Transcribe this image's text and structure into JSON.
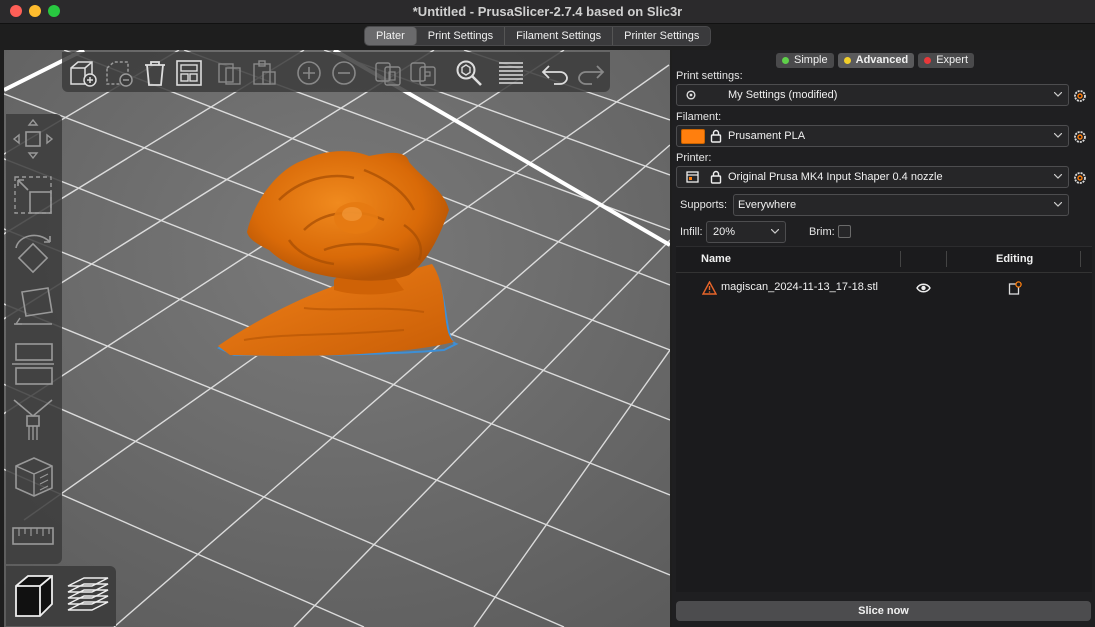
{
  "window": {
    "title": "*Untitled - PrusaSlicer-2.7.4 based on Slic3r"
  },
  "tabs": [
    {
      "label": "Plater",
      "active": true
    },
    {
      "label": "Print Settings",
      "active": false
    },
    {
      "label": "Filament Settings",
      "active": false
    },
    {
      "label": "Printer Settings",
      "active": false
    }
  ],
  "modes": [
    {
      "label": "Simple",
      "color": "#5fd04a",
      "active": false
    },
    {
      "label": "Advanced",
      "color": "#f2cf2a",
      "active": true
    },
    {
      "label": "Expert",
      "color": "#e8383a",
      "active": false
    }
  ],
  "print_settings": {
    "label": "Print settings:",
    "value": "My Settings (modified)"
  },
  "filament": {
    "label": "Filament:",
    "value": "Prusament PLA",
    "color": "#ff7f0e"
  },
  "printer": {
    "label": "Printer:",
    "value": "Original Prusa MK4 Input Shaper 0.4 nozzle"
  },
  "supports": {
    "label": "Supports:",
    "value": "Everywhere"
  },
  "infill": {
    "label": "Infill:",
    "value": "20%"
  },
  "brim": {
    "label": "Brim:",
    "checked": false
  },
  "object_list": {
    "columns": {
      "name": "Name",
      "editing": "Editing"
    },
    "rows": [
      {
        "name": "magiscan_2024-11-13_17-18.stl",
        "warning": true,
        "visible": true
      }
    ]
  },
  "actions": {
    "slice": "Slice now"
  },
  "icons": {
    "toolbar_top": [
      "add-icon",
      "delete-icon",
      "delete-all-icon",
      "arrange-icon",
      "copy-icon",
      "paste-icon",
      "add-instance-icon",
      "remove-instance-icon",
      "split-objects-icon",
      "split-parts-icon",
      "search-icon",
      "layers-editing-icon",
      "undo-icon",
      "redo-icon"
    ],
    "toolbar_left": [
      "move-icon",
      "scale-icon",
      "rotate-icon",
      "place-on-face-icon",
      "cut-icon",
      "paint-supports-icon",
      "measure-icon"
    ],
    "view": [
      "3d-view-icon",
      "preview-icon"
    ]
  },
  "colors": {
    "model": "#e8740f",
    "accent": "#ff7f0e",
    "bed": "#6e6e6e"
  }
}
